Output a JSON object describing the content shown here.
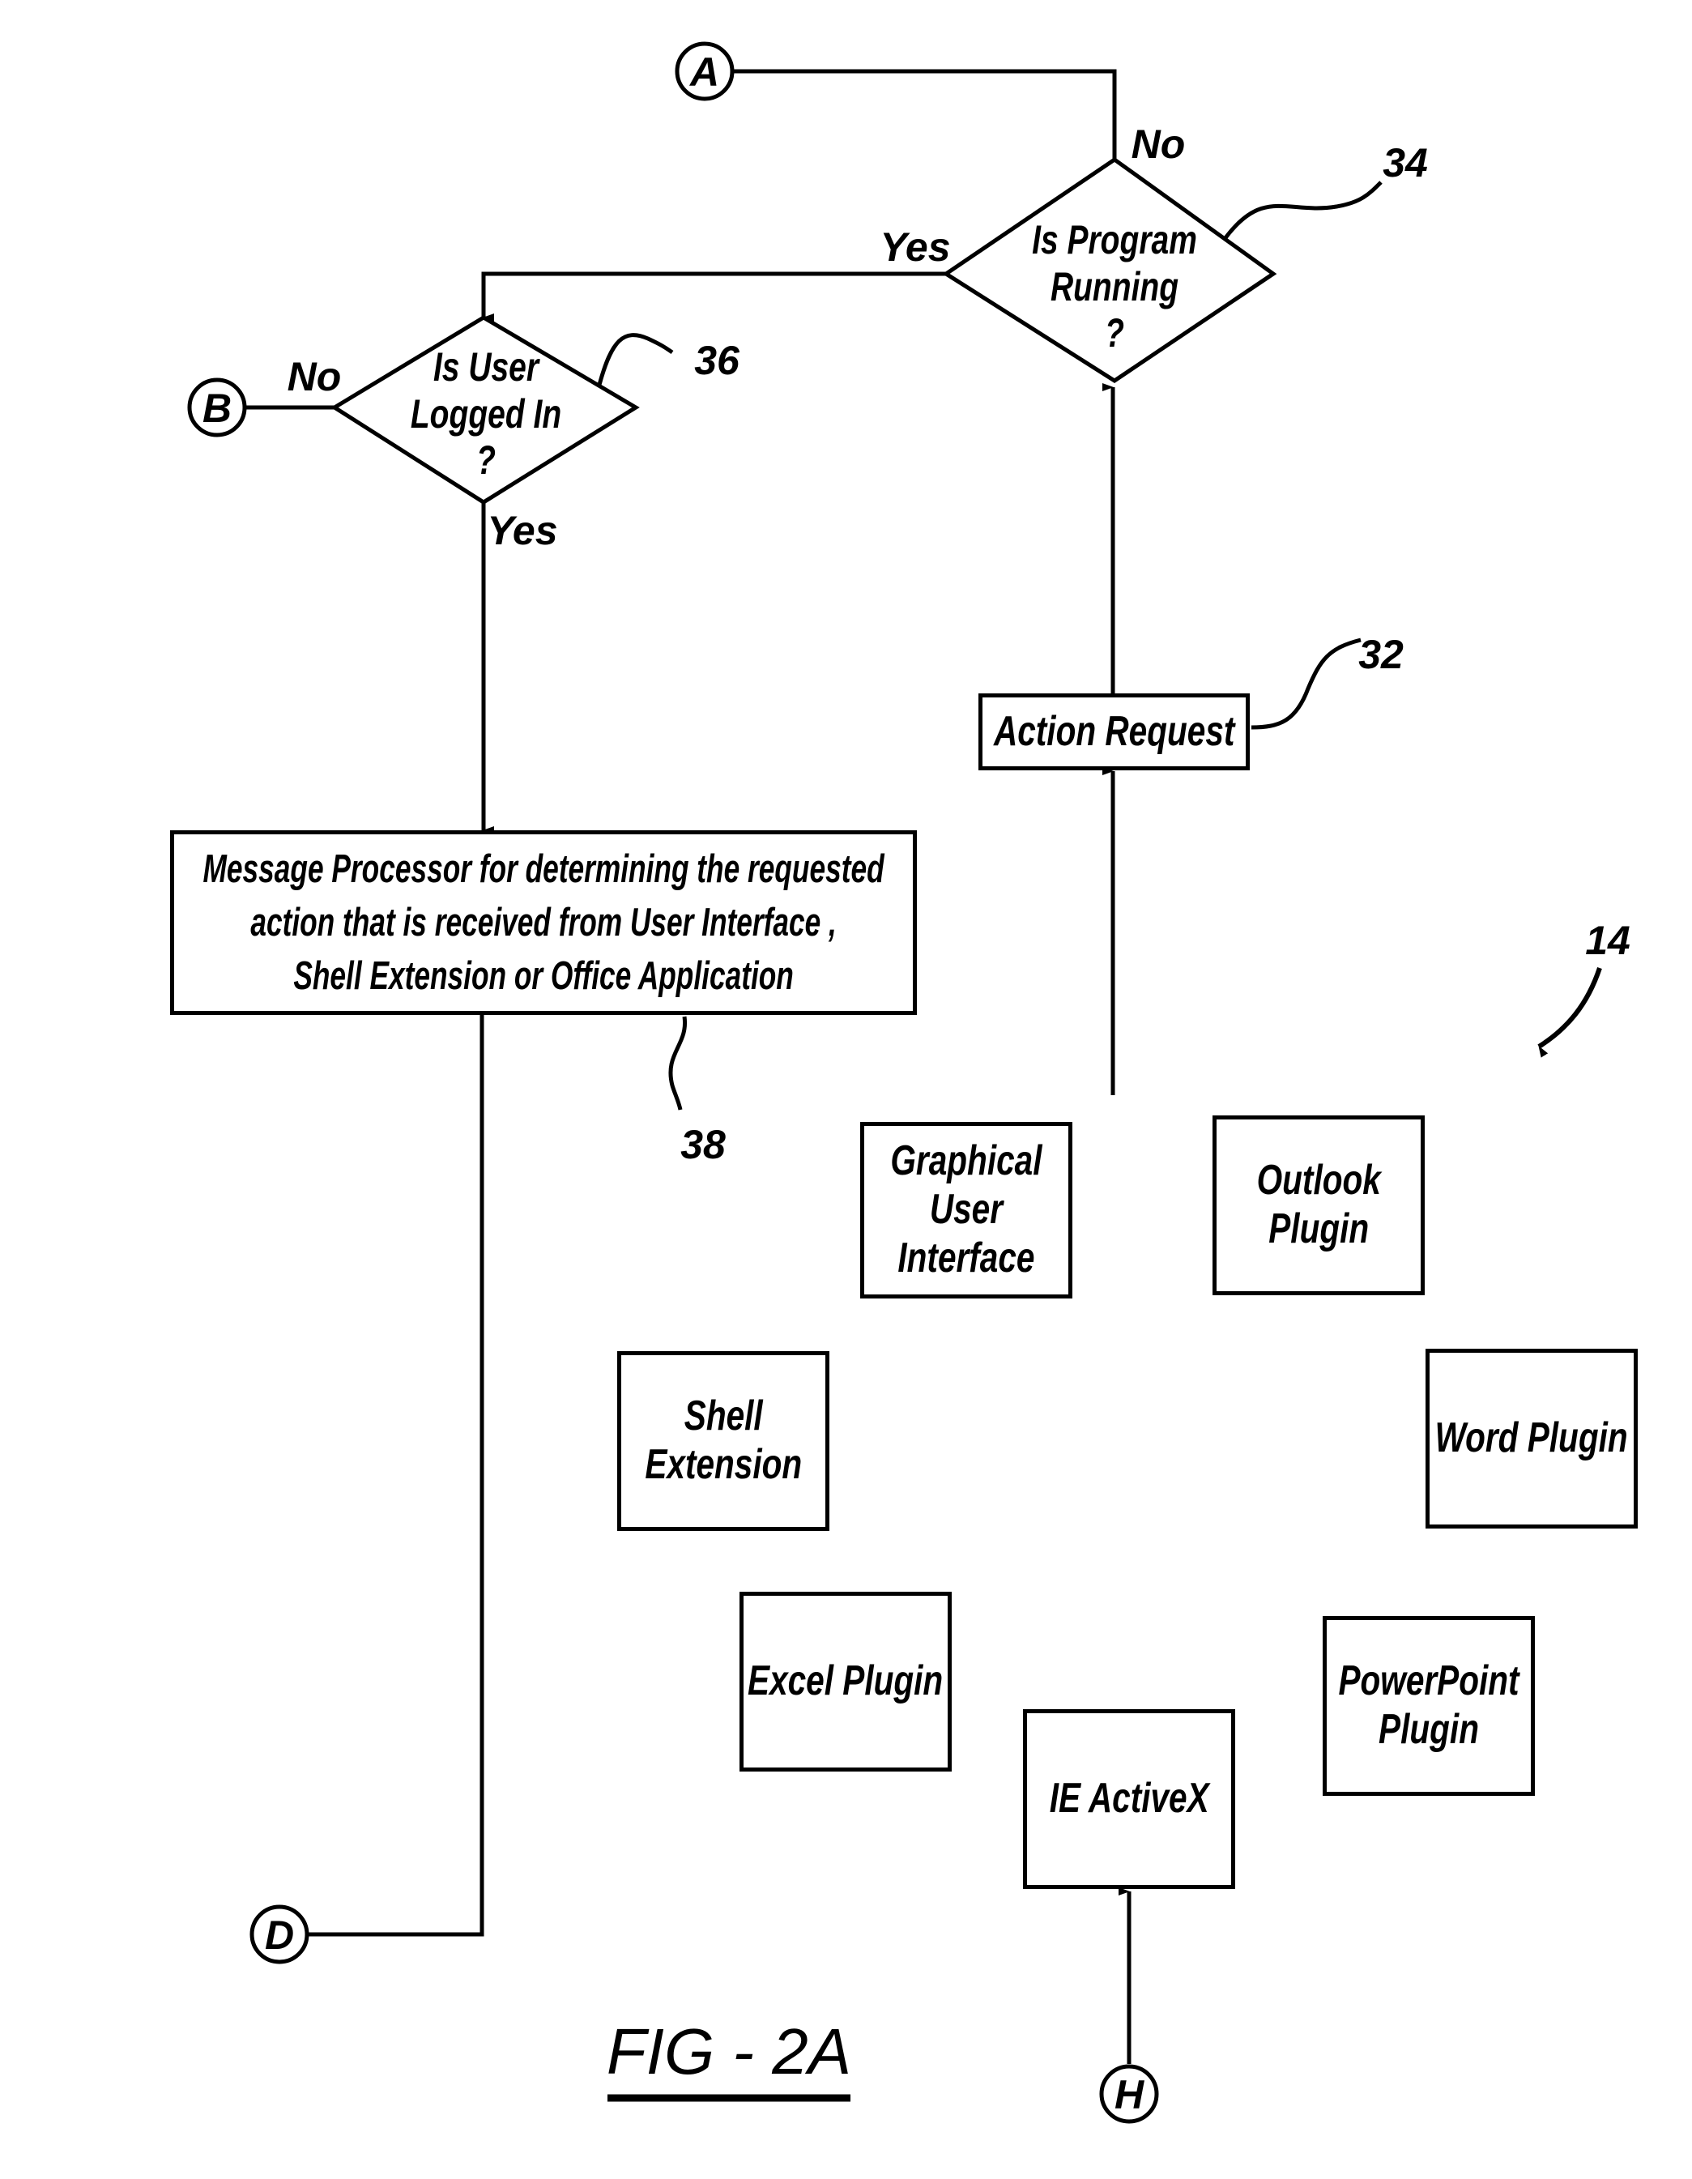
{
  "figure": {
    "caption": "FIG - 2A",
    "reference_system": "14"
  },
  "connectors": {
    "a": "A",
    "b": "B",
    "d": "D",
    "h": "H"
  },
  "decisions": {
    "program_running": {
      "line1": "Is Program",
      "line2": "Running",
      "line3": "?",
      "ref": "34",
      "yes_label": "Yes",
      "no_label": "No"
    },
    "user_logged_in": {
      "line1": "Is User",
      "line2": "Logged In",
      "line3": "?",
      "ref": "36",
      "yes_label": "Yes",
      "no_label": "No"
    }
  },
  "processes": {
    "action_request": {
      "label": "Action Request",
      "ref": "32"
    },
    "message_processor": {
      "line1": "Message Processor  for determining the requested",
      "line2": "action that is received from  User Interface ,",
      "line3": "Shell Extension or  Office Application",
      "ref": "38"
    }
  },
  "sources": [
    {
      "id": "gui",
      "lines": [
        "Graphical",
        "User",
        "Interface"
      ]
    },
    {
      "id": "outlook",
      "lines": [
        "Outlook",
        "Plugin"
      ]
    },
    {
      "id": "shell",
      "lines": [
        "Shell",
        "Extension"
      ]
    },
    {
      "id": "word",
      "lines": [
        "Word Plugin"
      ]
    },
    {
      "id": "excel",
      "lines": [
        "Excel Plugin"
      ]
    },
    {
      "id": "powerpoint",
      "lines": [
        "PowerPoint",
        "Plugin"
      ]
    },
    {
      "id": "ie",
      "lines": [
        "IE ActiveX"
      ]
    }
  ]
}
